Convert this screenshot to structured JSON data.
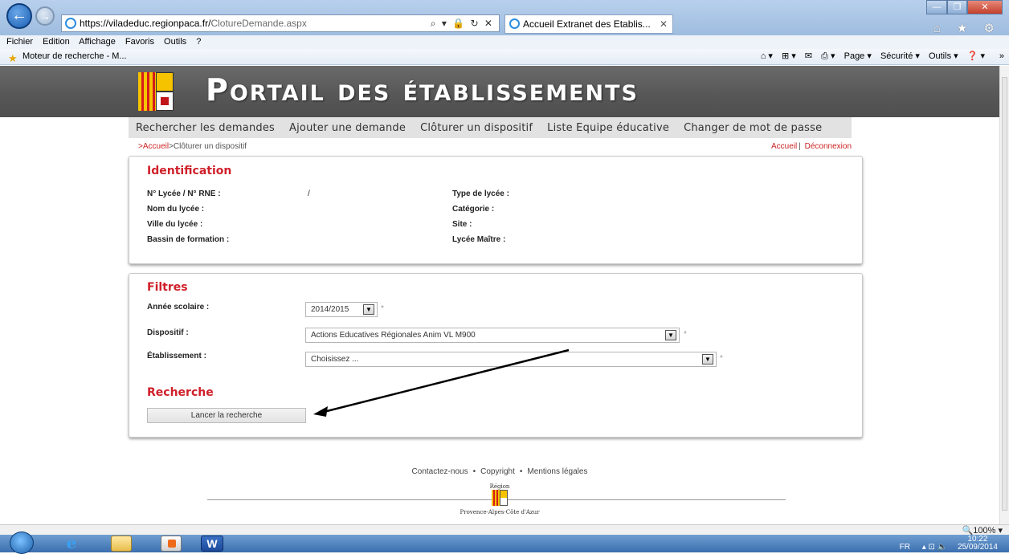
{
  "browser": {
    "back_label": "←",
    "forward_label": "→",
    "url_host": "https://viladeduc.regionpaca.fr/",
    "url_path": "ClotureDemande.aspx",
    "address_tools": "⌕ ▾ 🔒 ↻ ✕",
    "tab_title": "Accueil Extranet des Etablis...",
    "tab_close": "✕",
    "win_min": "—",
    "win_max": "❐",
    "win_close": "✕",
    "right_icons": "⌂ ★ ⚙",
    "menu": [
      "Fichier",
      "Edition",
      "Affichage",
      "Favoris",
      "Outils",
      "?"
    ],
    "favorites_link": "Moteur de recherche - M...",
    "commands": [
      "⌂ ▾",
      "⊞ ▾",
      "✉",
      "⎙ ▾",
      "Page ▾",
      "Sécurité ▾",
      "Outils ▾",
      "❓ ▾"
    ],
    "zoom": "🔍100% ▾",
    "favorites_more": "»"
  },
  "site": {
    "title": "Portail des établissements",
    "nav": [
      "Rechercher les demandes",
      "Ajouter une demande",
      "Clôturer un dispositif",
      "Liste Equipe éducative",
      "Changer de mot de passe"
    ],
    "breadcrumb_home": ">Accueil",
    "breadcrumb_current": ">Clôturer un dispositif",
    "link_home": "Accueil",
    "link_sep": "|",
    "link_logout": "Déconnexion"
  },
  "identification": {
    "title": "Identification",
    "rne_label": "N° Lycée / N° RNE :",
    "rne_value": "/",
    "name_label": "Nom du lycée :",
    "city_label": "Ville du lycée :",
    "basin_label": "Bassin de formation :",
    "type_label": "Type de lycée :",
    "category_label": "Catégorie :",
    "site_label": "Site :",
    "master_label": "Lycée Maître :"
  },
  "filters": {
    "title": "Filtres",
    "year_label": "Année scolaire :",
    "year_value": "2014/2015",
    "device_label": "Dispositif :",
    "device_value": "Actions Educatives Régionales Anim VL M900",
    "school_label": "Établissement :",
    "school_value": "Choisissez ...",
    "required_mark": "*",
    "search_title": "Recherche",
    "search_button": "Lancer la recherche",
    "dropdown_glyph": "▼"
  },
  "footer": {
    "contact": "Contactez-nous",
    "copyright": "Copyright",
    "legal": "Mentions légales",
    "bullet": "•",
    "region_top": "Région",
    "region_bottom": "Provence-Alpes-Côte d'Azur"
  },
  "taskbar": {
    "word_label": "W",
    "ie_label": "e",
    "language": "FR",
    "tray_icons": "▴ ⊡ 🔈",
    "time": "10:22",
    "date": "25/09/2014"
  },
  "colors": {
    "accent_red": "#d0202a",
    "header_gray": "#565656",
    "nav_gray": "#e2e2e2"
  }
}
